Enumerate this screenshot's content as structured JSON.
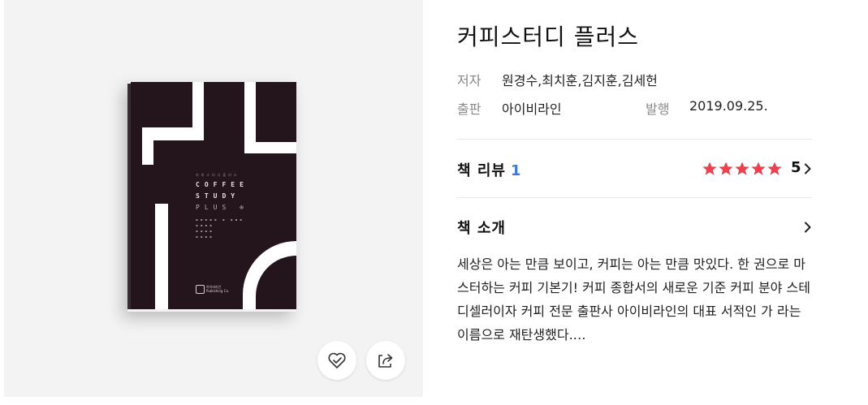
{
  "book": {
    "title": "커피스터디 플러스",
    "author_label": "저자",
    "author": "원경수,최치훈,김지훈,김세헌",
    "publisher_label": "출판",
    "publisher": "아이비라인",
    "pubdate_label": "발행",
    "pubdate": "2019.09.25."
  },
  "cover": {
    "line1": "커피스터디플러스",
    "line2": "COFFEE",
    "line3": "STUDY",
    "line4": "PLUS ⊕",
    "logo_line1": "아이비라인",
    "logo_line2": "Publishing Co."
  },
  "review": {
    "label": "책 리뷰",
    "count": "1",
    "rating": 5,
    "rating_text": "5",
    "star_color": "#e9434f"
  },
  "intro": {
    "label": "책 소개",
    "text": "세상은 아는 만큼 보이고, 커피는 아는 만큼 맛있다. 한 권으로 마스터하는 커피 기본기! 커피 종합서의 새로운 기준 커피 분야 스테디셀러이자 커피 전문 출판사 아이비라인의 대표 서적인 가 라는 이름으로 재탄생했다.…"
  },
  "icons": {
    "like": "heart-check-icon",
    "share": "share-icon"
  }
}
